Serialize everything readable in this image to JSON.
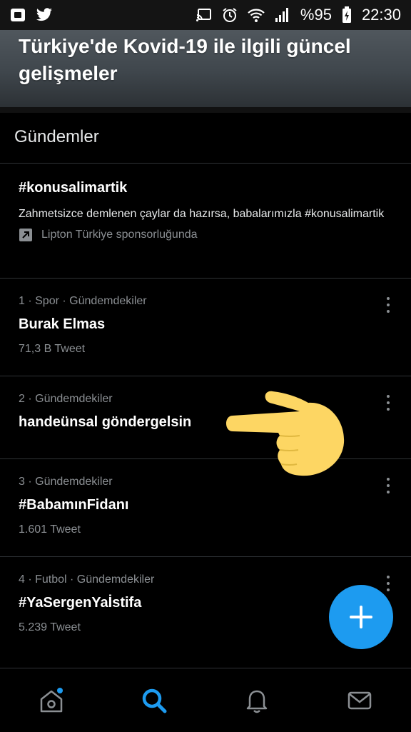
{
  "status_bar": {
    "battery_text": "%95",
    "time": "22:30",
    "icons": [
      "notification-square-icon",
      "twitter-bird-icon",
      "cast-icon",
      "alarm-icon",
      "wifi-icon",
      "signal-icon",
      "battery-charging-icon"
    ]
  },
  "hero": {
    "title": "Türkiye'de Kovid-19 ile ilgili güncel gelişmeler"
  },
  "section": {
    "title": "Gündemler"
  },
  "promoted": {
    "tag": "#konusalimartik",
    "description": "Zahmetsizce demlenen çaylar da hazırsa, babalarımızla #konusalimartik",
    "sponsor": "Lipton Türkiye sponsorluğunda"
  },
  "trends": [
    {
      "meta": "1 · Spor · Gündemdekiler",
      "name": "Burak Elmas",
      "count": "71,3 B Tweet"
    },
    {
      "meta": "2 · Gündemdekiler",
      "name": "handeünsal göndergelsin",
      "count": ""
    },
    {
      "meta": "3 · Gündemdekiler",
      "name": "#BabamınFidanı",
      "count": "1.601 Tweet"
    },
    {
      "meta": "4 · Futbol · Gündemdekiler",
      "name": "#YaSergenYaİstifa",
      "count": "5.239 Tweet"
    }
  ],
  "fab": {
    "icon": "plus-icon"
  },
  "tabbar": {
    "tabs": [
      "home-icon",
      "search-icon",
      "bell-icon",
      "mail-icon"
    ],
    "active": "search-icon"
  },
  "colors": {
    "accent": "#1d9bf0",
    "background": "#000000",
    "secondary_text": "#8b8f93",
    "pointer_emoji": "#fdd663"
  }
}
